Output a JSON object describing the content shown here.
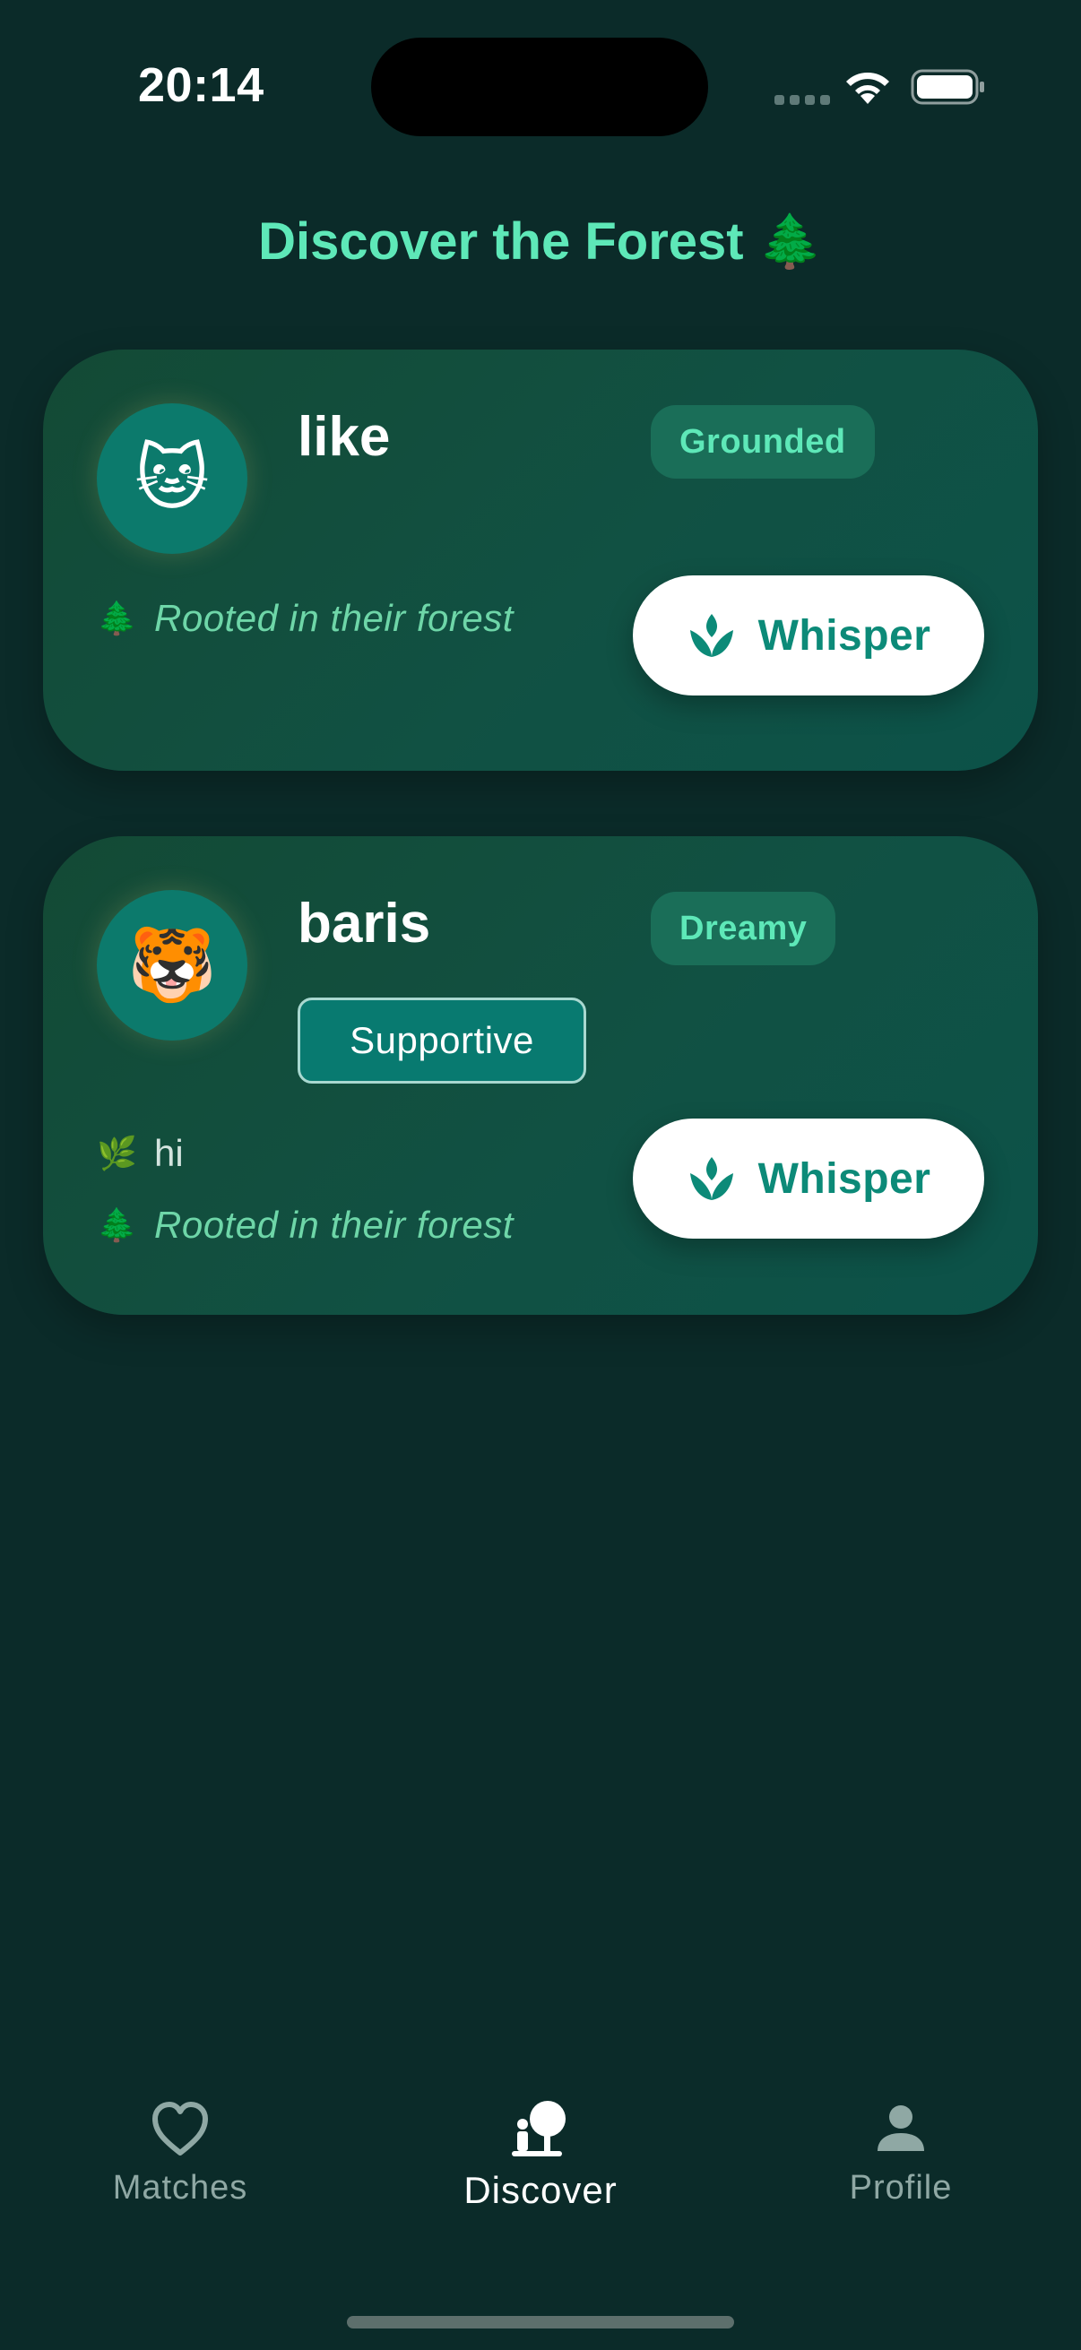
{
  "status_bar": {
    "time": "20:14"
  },
  "header": {
    "title": "Discover the Forest 🌲"
  },
  "cards": [
    {
      "avatar_emoji": "🐱",
      "name": "like",
      "mood": "Grounded",
      "tags": [],
      "bio": "",
      "bio_icon": "🌿",
      "status_icon": "🌲",
      "status": "Rooted in their forest",
      "action_label": "Whisper",
      "action_icon": "sprout-icon"
    },
    {
      "avatar_emoji": "🐯",
      "name": "baris",
      "mood": "Dreamy",
      "tags": [
        "Supportive"
      ],
      "bio": "hi",
      "bio_icon": "🌿",
      "status_icon": "🌲",
      "status": "Rooted in their forest",
      "action_label": "Whisper",
      "action_icon": "sprout-icon"
    }
  ],
  "tab_bar": {
    "active": "Discover",
    "tabs": [
      {
        "label": "Matches",
        "icon": "heart-outline-icon"
      },
      {
        "label": "Discover",
        "icon": "person-tree-icon"
      },
      {
        "label": "Profile",
        "icon": "person-icon"
      }
    ]
  },
  "colors": {
    "background": "#0b2b29",
    "accent": "#5ee8b8",
    "button_text": "#0c8a78",
    "card": "#115143"
  }
}
